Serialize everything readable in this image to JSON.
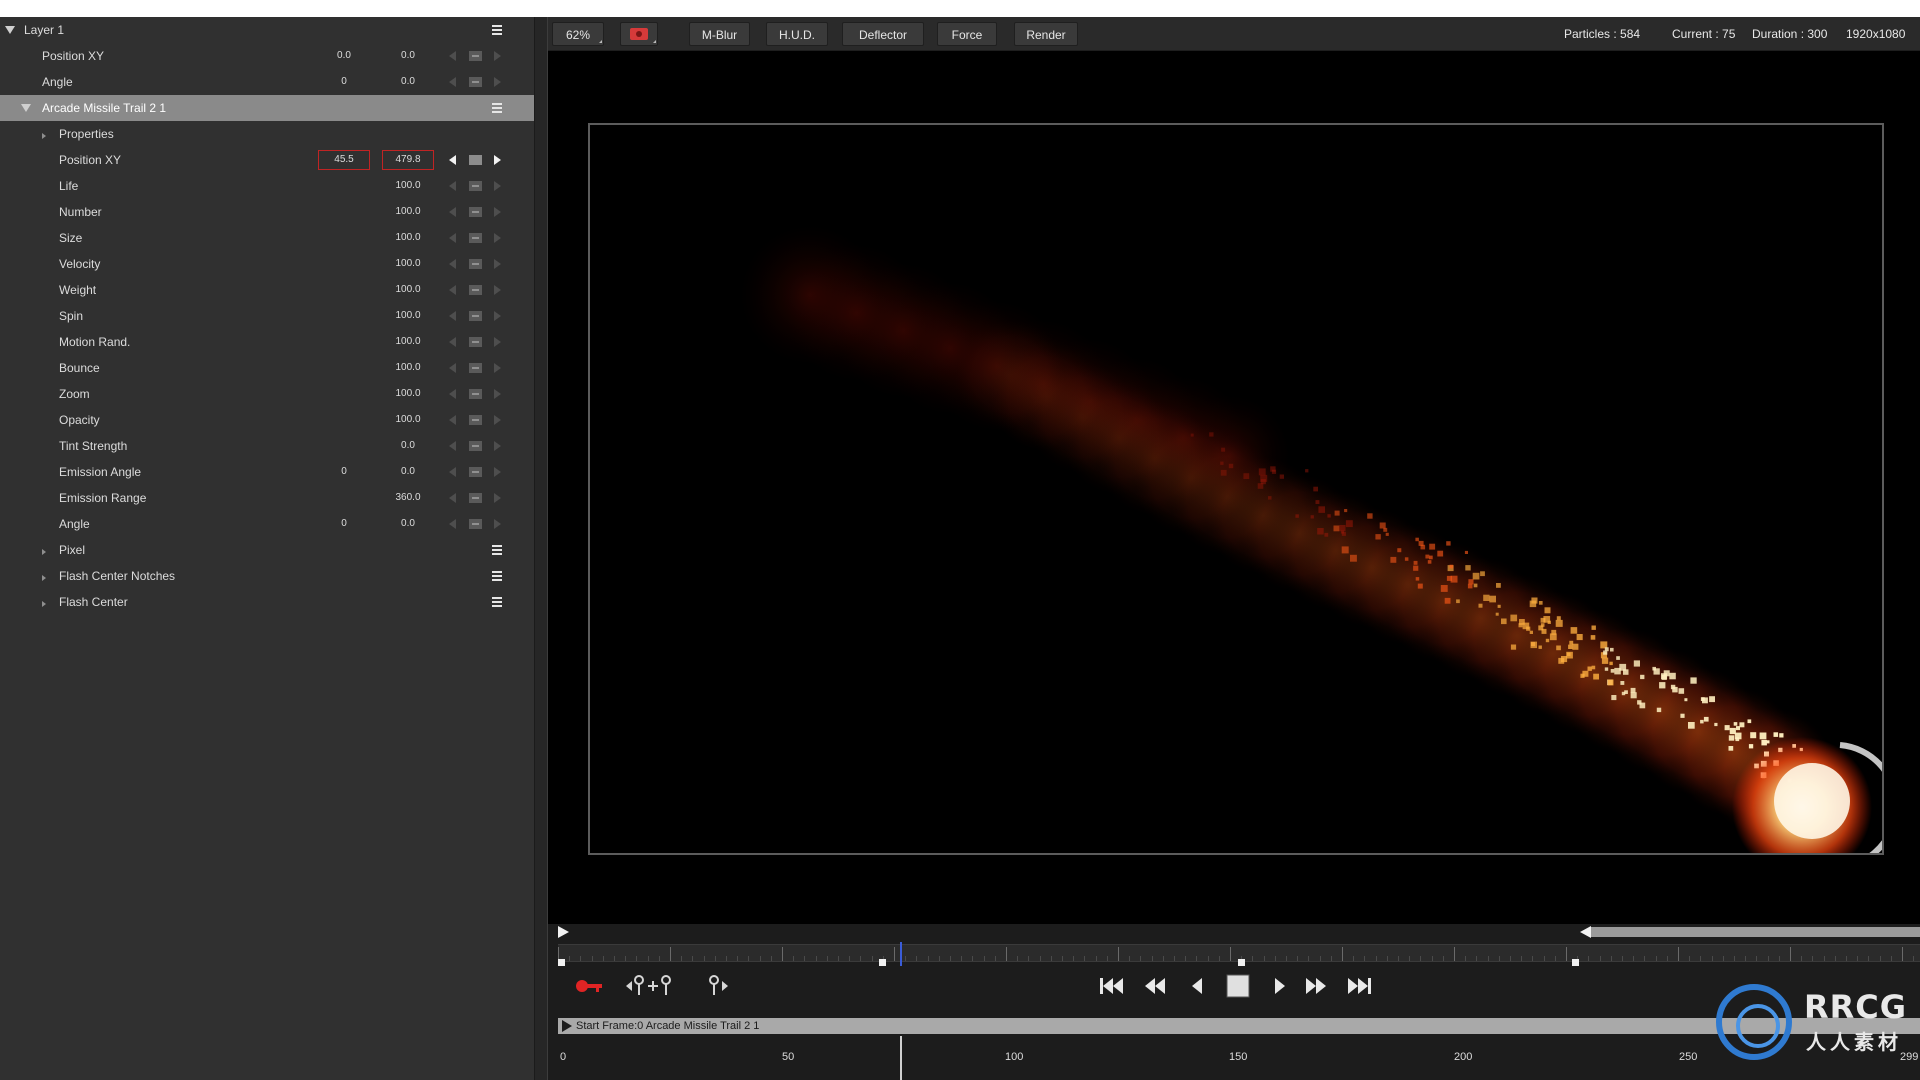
{
  "toolbar": {
    "zoom": "62%",
    "buttons": [
      "M-Blur",
      "H.U.D.",
      "Deflector",
      "Force",
      "Render"
    ],
    "stats": {
      "particles": "Particles : 584",
      "current": "Current : 75",
      "duration": "Duration : 300",
      "resolution": "1920x1080"
    }
  },
  "layers": {
    "layer1": {
      "name": "Layer 1",
      "position_label": "Position XY",
      "position_x": "0.0",
      "position_y": "0.0",
      "angle_label": "Angle",
      "angle_value1": "0",
      "angle_value2": "0.0"
    },
    "emitter": {
      "name": "Arcade Missile Trail 2 1",
      "properties_label": "Properties",
      "position_label": "Position XY",
      "position_x": "45.5",
      "position_y": "479.8",
      "params": [
        {
          "label": "Life",
          "value": "100.0"
        },
        {
          "label": "Number",
          "value": "100.0"
        },
        {
          "label": "Size",
          "value": "100.0"
        },
        {
          "label": "Velocity",
          "value": "100.0"
        },
        {
          "label": "Weight",
          "value": "100.0"
        },
        {
          "label": "Spin",
          "value": "100.0"
        },
        {
          "label": "Motion Rand.",
          "value": "100.0"
        },
        {
          "label": "Bounce",
          "value": "100.0"
        },
        {
          "label": "Zoom",
          "value": "100.0"
        },
        {
          "label": "Opacity",
          "value": "100.0"
        },
        {
          "label": "Tint Strength",
          "value": "0.0"
        },
        {
          "label": "Emission Angle",
          "value1": "0",
          "value": "0.0"
        },
        {
          "label": "Emission Range",
          "value": "360.0"
        },
        {
          "label": "Angle",
          "value1": "0",
          "value": "0.0"
        }
      ],
      "groups": [
        "Pixel",
        "Flash Center Notches",
        "Flash Center"
      ]
    }
  },
  "timeline": {
    "track_label": "Start Frame:0 Arcade Missile Trail 2 1",
    "scale_labels": [
      "0",
      "50",
      "100",
      "150",
      "200",
      "250",
      "299"
    ]
  },
  "watermark": {
    "brand": "RRCG",
    "subtitle": "人人素材"
  }
}
